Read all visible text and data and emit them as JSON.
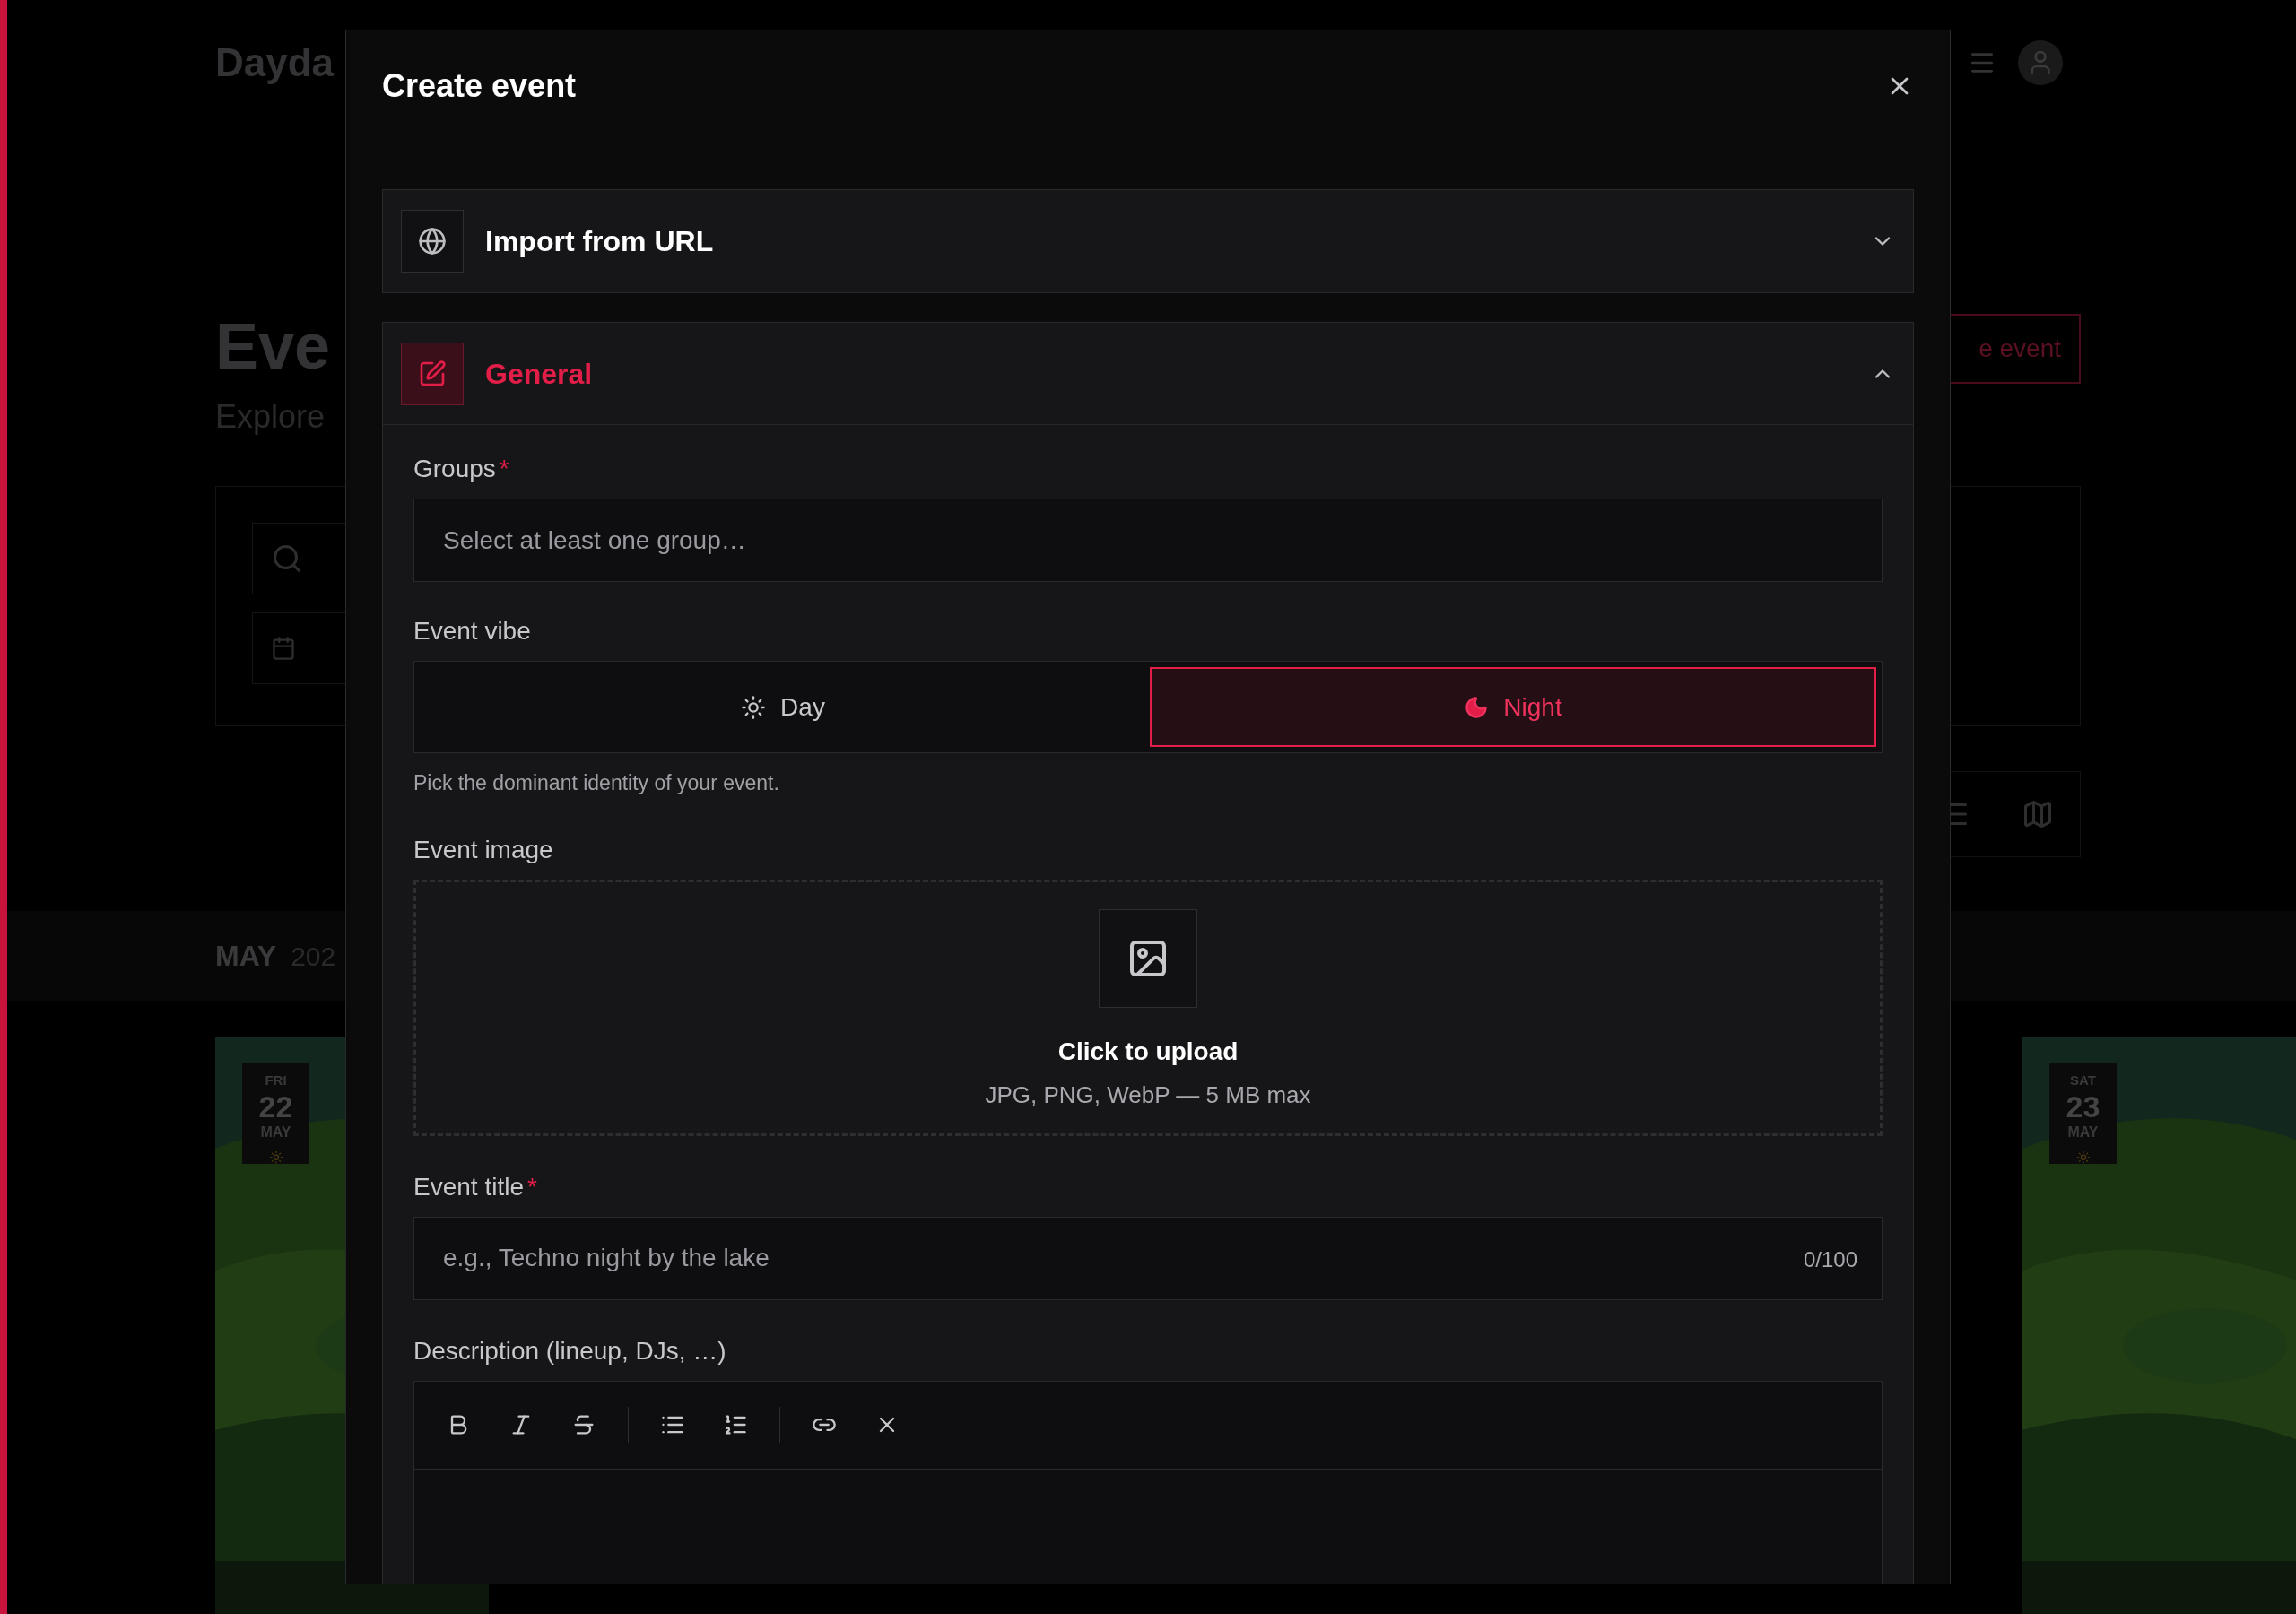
{
  "background": {
    "logo": "Dayda",
    "page_title": "Eve",
    "subtitle": "Explore",
    "create_button": "e event",
    "month": "MAY",
    "year": "202",
    "cards": [
      {
        "weekday": "FRI",
        "day": "22",
        "month": "MAY"
      },
      {
        "weekday": "SAT",
        "day": "23",
        "month": "MAY"
      }
    ]
  },
  "dialog": {
    "title": "Create event",
    "sections": [
      {
        "kind": "import",
        "title": "Import from URL",
        "expanded": false
      },
      {
        "kind": "general",
        "title": "General",
        "expanded": true
      }
    ],
    "groups": {
      "label": "Groups",
      "required_mark": "*",
      "placeholder": "Select at least one group…"
    },
    "vibe": {
      "label": "Event vibe",
      "options": [
        {
          "label": "Day",
          "kind": "day",
          "selected": false
        },
        {
          "label": "Night",
          "kind": "night",
          "selected": true
        }
      ],
      "help": "Pick the dominant identity of your event."
    },
    "image": {
      "label": "Event image",
      "cta": "Click to upload",
      "hint": "JPG, PNG, WebP — 5 MB max"
    },
    "title_field": {
      "label": "Event title",
      "required_mark": "*",
      "placeholder": "e.g., Techno night by the lake",
      "counter": "0/100"
    },
    "description": {
      "label": "Description (lineup, DJs, …)"
    }
  }
}
